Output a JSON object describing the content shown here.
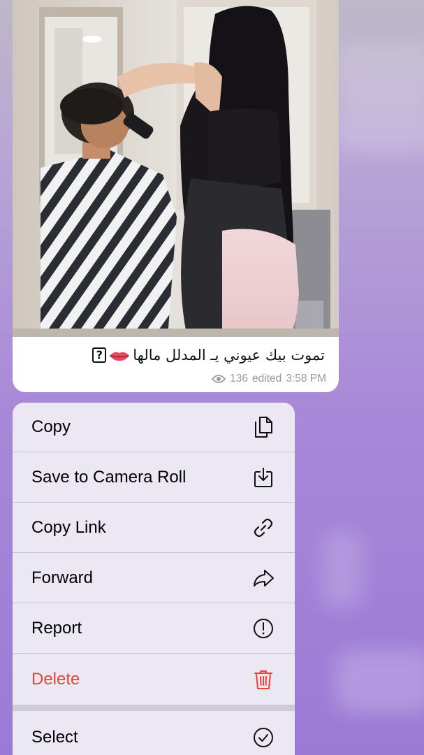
{
  "message": {
    "caption_text": "تموت بيك عيوني يـ المدلل مالها",
    "caption_emoji_icon": "lips-icon",
    "caption_unknown_glyph": "?",
    "views": "136",
    "status": "edited",
    "time": "3:58 PM"
  },
  "context_menu": {
    "items": [
      {
        "label": "Copy",
        "icon": "copy-icon"
      },
      {
        "label": "Save to Camera Roll",
        "icon": "download-icon"
      },
      {
        "label": "Copy Link",
        "icon": "link-icon"
      },
      {
        "label": "Forward",
        "icon": "forward-arrow-icon"
      },
      {
        "label": "Report",
        "icon": "exclamation-circle-icon"
      },
      {
        "label": "Delete",
        "icon": "trash-icon"
      },
      {
        "label": "Select",
        "icon": "checkmark-circle-icon"
      }
    ]
  },
  "colors": {
    "delete_red": "#e8433a",
    "meta_gray": "#9a9a9f",
    "background_purple": "#a888d8"
  }
}
